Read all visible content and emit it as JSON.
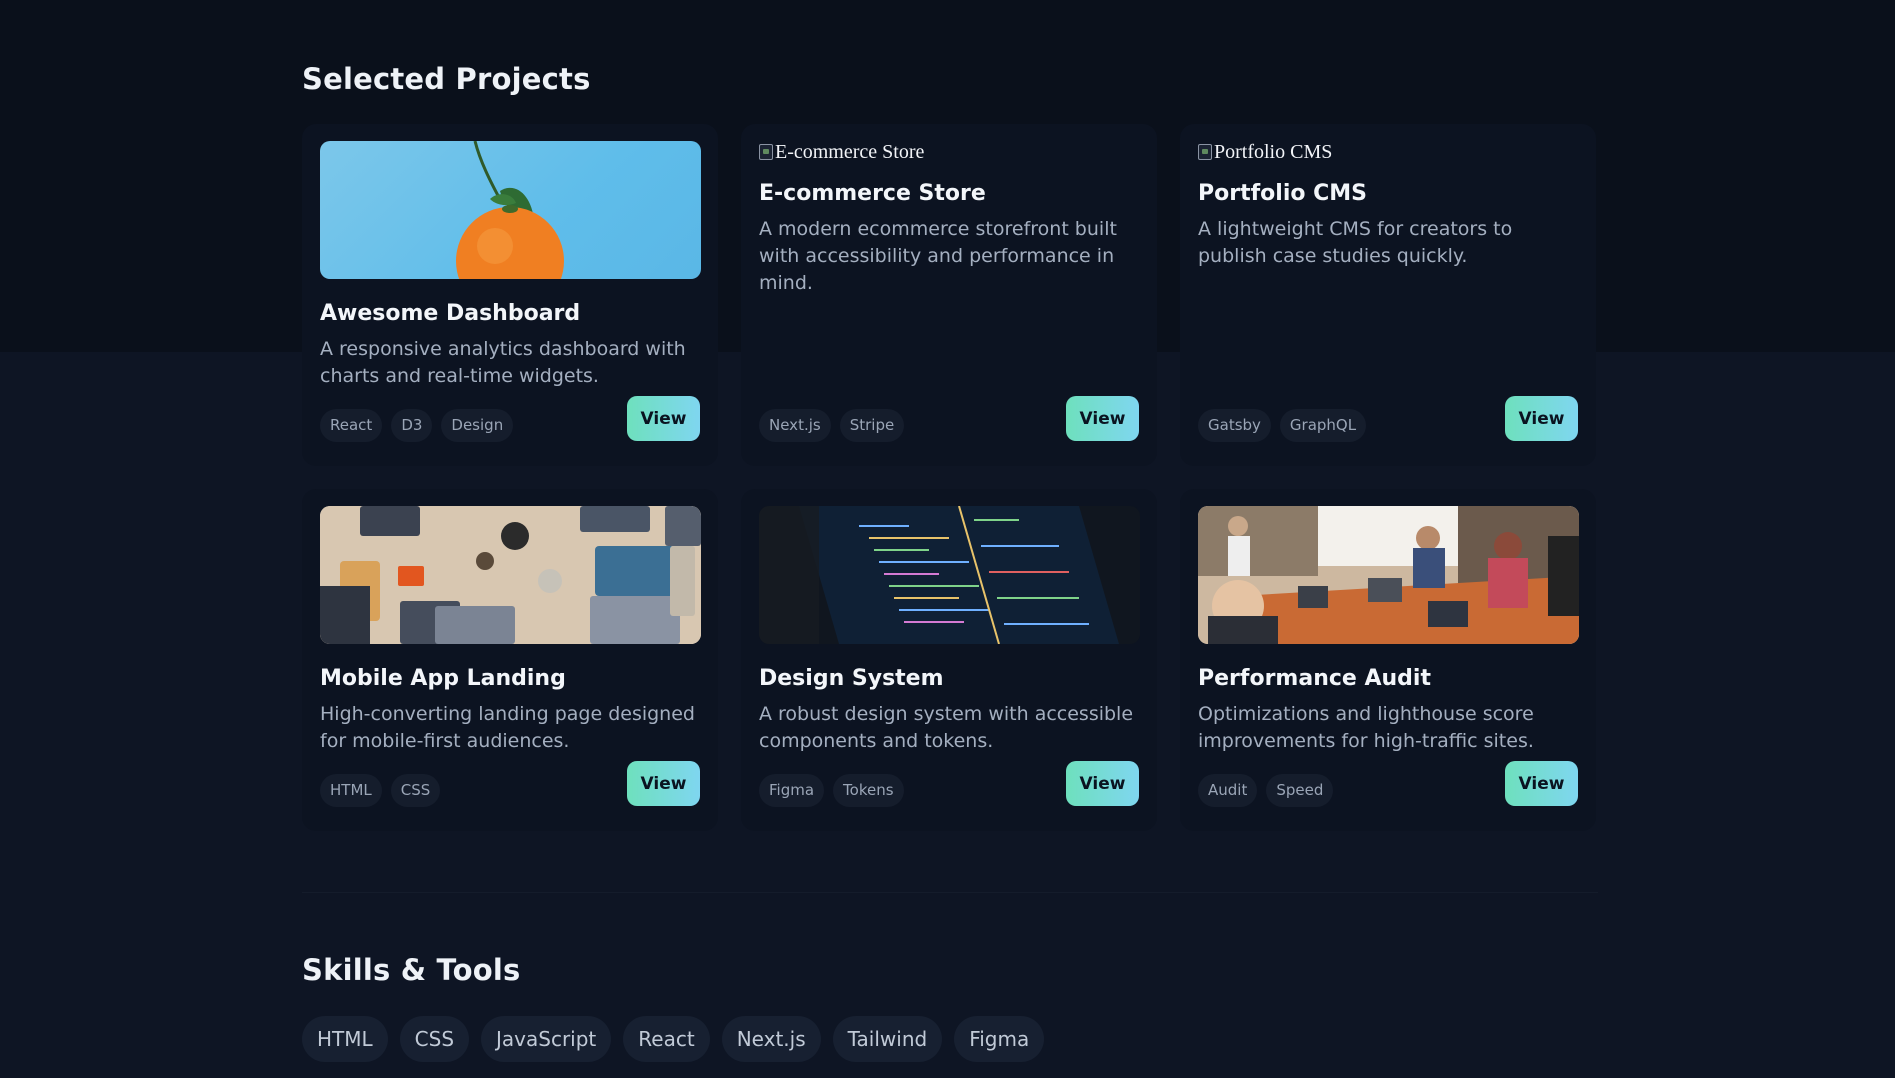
{
  "projects": {
    "title": "Selected Projects",
    "view_label": "View",
    "cards": [
      {
        "title": "Awesome Dashboard",
        "description": "A responsive analytics dashboard with charts and real-time widgets.",
        "image": "orange-photo",
        "tags": [
          "React",
          "D3",
          "Design"
        ]
      },
      {
        "title": "E-commerce Store",
        "description": "A modern ecommerce storefront built with accessibility and performance in mind.",
        "image_alt": "E-commerce Store",
        "tags": [
          "Next.js",
          "Stripe"
        ]
      },
      {
        "title": "Portfolio CMS",
        "description": "A lightweight CMS for creators to publish case studies quickly.",
        "image_alt": "Portfolio CMS",
        "tags": [
          "Gatsby",
          "GraphQL"
        ]
      },
      {
        "title": "Mobile App Landing",
        "description": "High-converting landing page designed for mobile-first audiences.",
        "image": "desk-laptops-photo",
        "tags": [
          "HTML",
          "CSS"
        ]
      },
      {
        "title": "Design System",
        "description": "A robust design system with accessible components and tokens.",
        "image": "code-screen-photo",
        "tags": [
          "Figma",
          "Tokens"
        ]
      },
      {
        "title": "Performance Audit",
        "description": "Optimizations and lighthouse score improvements for high-traffic sites.",
        "image": "meeting-room-photo",
        "tags": [
          "Audit",
          "Speed"
        ]
      }
    ]
  },
  "skills": {
    "title": "Skills & Tools",
    "items": [
      "HTML",
      "CSS",
      "JavaScript",
      "React",
      "Next.js",
      "Tailwind",
      "Figma"
    ]
  },
  "colors": {
    "accent_gradient_start": "#6ee0bd",
    "accent_gradient_end": "#7fd6f0",
    "background": "#0d1422",
    "card": "#0c1321"
  }
}
